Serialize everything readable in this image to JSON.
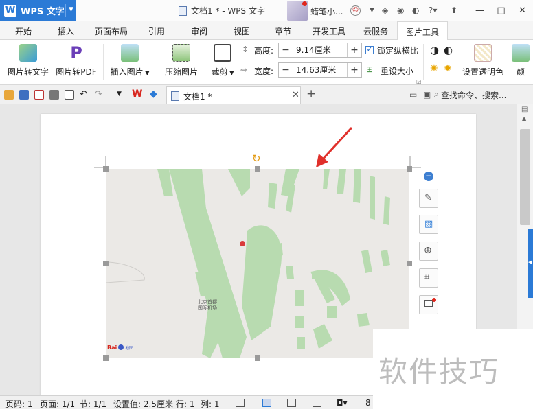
{
  "titlebar": {
    "app_name": "WPS 文字",
    "document_title": "文档1 * - WPS 文字",
    "user_name": "蜡笔小...",
    "controls": [
      "—",
      "□",
      "✕"
    ]
  },
  "tabs": [
    {
      "label": "开始",
      "active": false
    },
    {
      "label": "插入",
      "active": false
    },
    {
      "label": "页面布局",
      "active": false
    },
    {
      "label": "引用",
      "active": false
    },
    {
      "label": "审阅",
      "active": false
    },
    {
      "label": "视图",
      "active": false
    },
    {
      "label": "章节",
      "active": false
    },
    {
      "label": "开发工具",
      "active": false
    },
    {
      "label": "云服务",
      "active": false
    },
    {
      "label": "图片工具",
      "active": true
    }
  ],
  "ribbon": {
    "pic_to_text": "图片转文字",
    "pic_to_pdf": "图片转PDF",
    "insert_picture": "插入图片",
    "compress_picture": "压缩图片",
    "crop": "裁剪",
    "height_label": "高度:",
    "height_value": "9.14厘米",
    "width_label": "宽度:",
    "width_value": "14.63厘米",
    "lock_ratio": "锁定纵横比",
    "lock_ratio_checked": true,
    "reset_size": "重设大小",
    "set_transparent": "设置透明色",
    "color_partial": "颜"
  },
  "quickbar": {
    "doc_tab": "文档1 *",
    "search": "查找命令、搜索..."
  },
  "map": {
    "label_line1": "北京首都",
    "label_line2": "国际机场",
    "logo": "Bai",
    "logo_suffix": "地图"
  },
  "statusbar": {
    "page_num": "页码: 1",
    "page_count": "页面: 1/1",
    "section": "节: 1/1",
    "setting": "设置值: 2.5厘米",
    "row": "行: 1",
    "col": "列: 1",
    "zoom_partial": "8"
  },
  "watermark": "软件技巧",
  "colors": {
    "accent": "#2b7ad6",
    "map_green": "#b8dbb0",
    "map_bg": "#ebe9e6",
    "arrow_red": "#e0302b"
  }
}
